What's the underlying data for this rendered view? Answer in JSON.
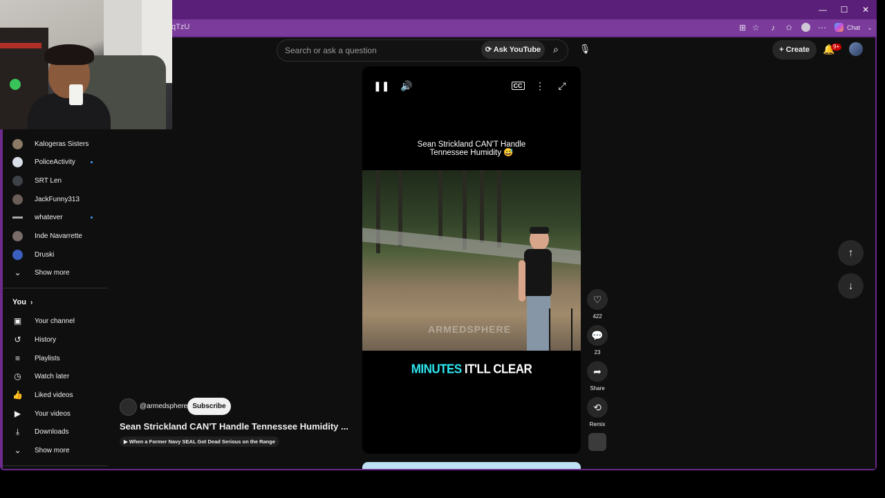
{
  "browser": {
    "url_fragment": "qTzU",
    "chat_label": "Chat",
    "window_controls": {
      "minimize": "—",
      "maximize": "☐",
      "close": "✕"
    }
  },
  "header": {
    "search_placeholder": "Search or ask a question",
    "ask_label": "Ask YouTube",
    "create_label": "Create",
    "notification_badge": "9+"
  },
  "sidebar": {
    "subscriptions": [
      {
        "label": "Kalogeras Sisters",
        "color": "#8a7a66",
        "new": false
      },
      {
        "label": "PoliceActivity",
        "color": "#d9dfe8",
        "new": true
      },
      {
        "label": "SRT Len",
        "color": "#3d4148",
        "new": false
      },
      {
        "label": "JackFunny313",
        "color": "#6b5d57",
        "new": false
      },
      {
        "label": "whatever",
        "color": "#aaaaaa",
        "new": true
      },
      {
        "label": "Inde Navarrette",
        "color": "#7a6c68",
        "new": false
      },
      {
        "label": "Druski",
        "color": "#3b5fbf",
        "new": false
      }
    ],
    "show_more_1": "Show more",
    "you_label": "You",
    "you_items": [
      {
        "label": "Your channel",
        "icon": "channel-icon"
      },
      {
        "label": "History",
        "icon": "history-icon"
      },
      {
        "label": "Playlists",
        "icon": "playlists-icon"
      },
      {
        "label": "Watch later",
        "icon": "watch-later-icon"
      },
      {
        "label": "Liked videos",
        "icon": "like-icon"
      },
      {
        "label": "Your videos",
        "icon": "your-videos-icon"
      },
      {
        "label": "Downloads",
        "icon": "download-icon"
      }
    ],
    "show_more_2": "Show more"
  },
  "player": {
    "caption_top_line1": "Sean Strickland CAN'T Handle",
    "caption_top_line2": "Tennessee Humidity 😅",
    "caption_mid_word1": "MINUTES",
    "caption_mid_word2": " IT'LL CLEAR",
    "caption_mid_color1": "#2ee6f0",
    "watermark": "ARMEDSPHERE"
  },
  "actions": {
    "likes": "422",
    "comments": "23",
    "share": "Share",
    "remix": "Remix"
  },
  "video": {
    "channel": "@armedsphere",
    "subscribe": "Subscribe",
    "title": "Sean Strickland CAN'T Handle Tennessee Humidity ...",
    "related": "When a Former Navy SEAL Got Dead Serious on the Range"
  }
}
